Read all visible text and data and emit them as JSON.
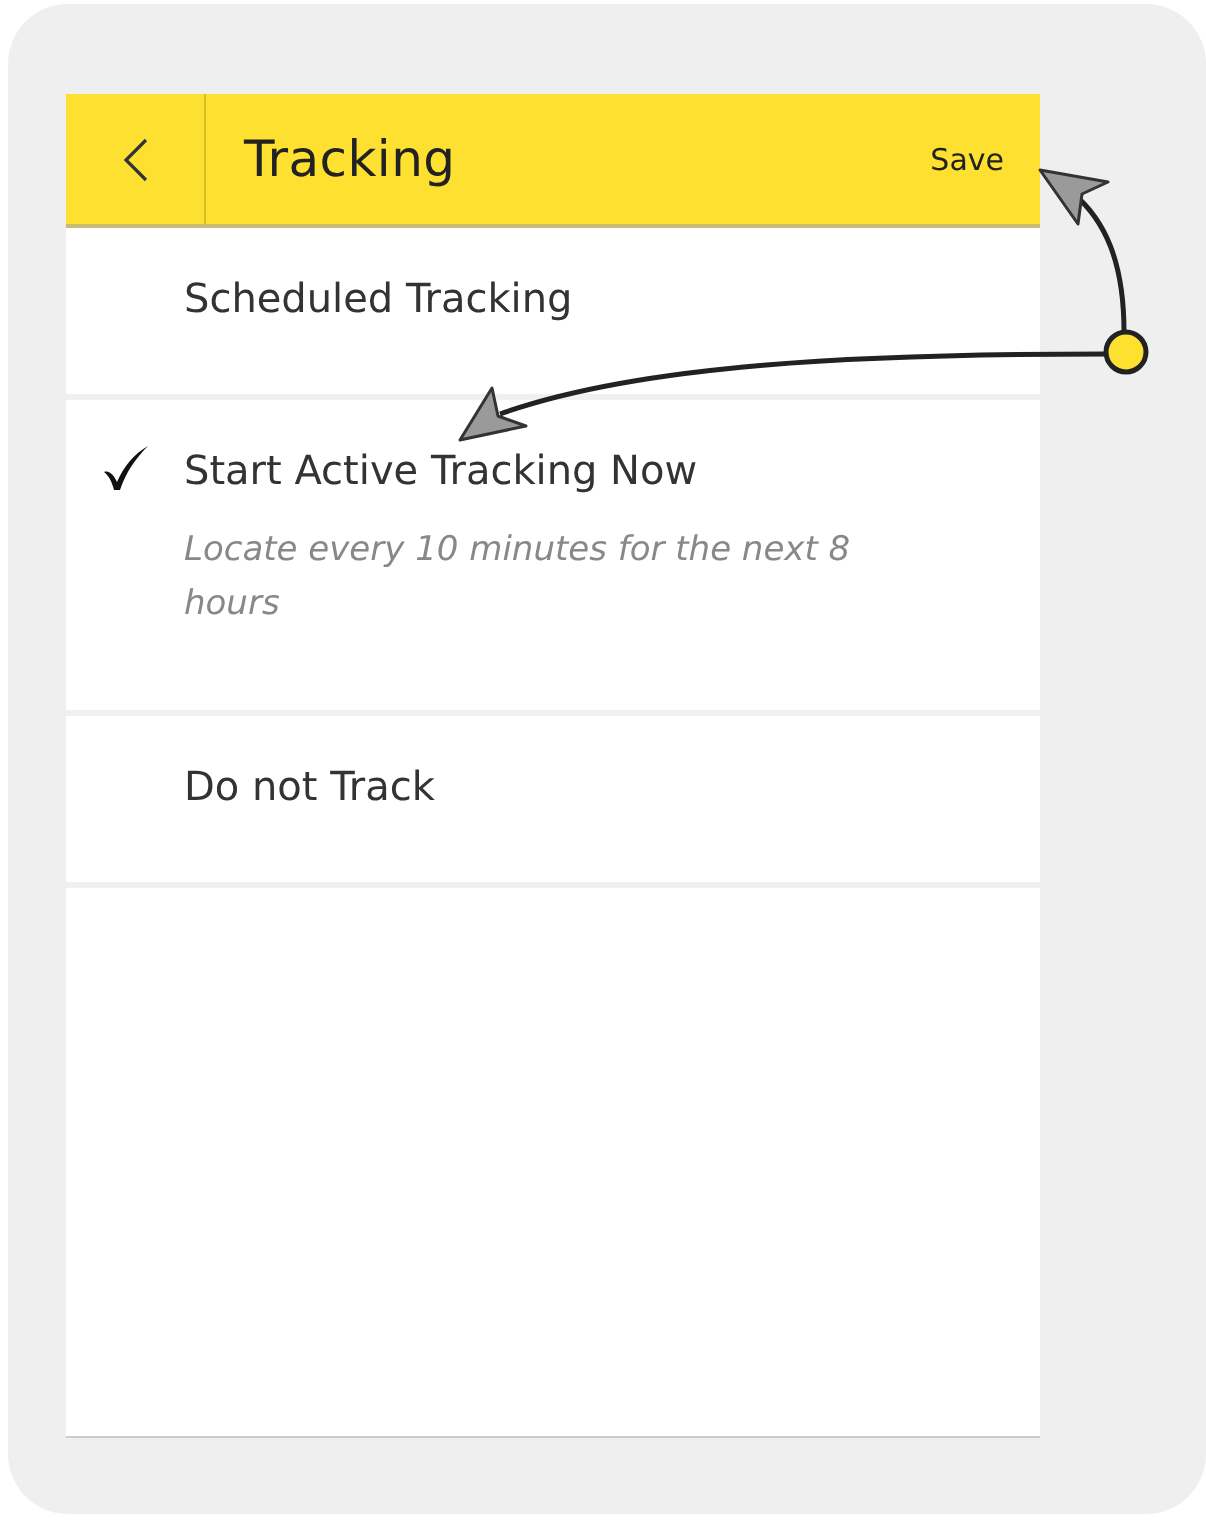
{
  "header": {
    "title": "Tracking",
    "action": "Save"
  },
  "options": [
    {
      "label": "Scheduled Tracking",
      "selected": false
    },
    {
      "label": "Start Active Tracking Now",
      "selected": true,
      "description": "Locate every 10 minutes for the next 8 hours"
    },
    {
      "label": "Do not Track",
      "selected": false
    }
  ]
}
